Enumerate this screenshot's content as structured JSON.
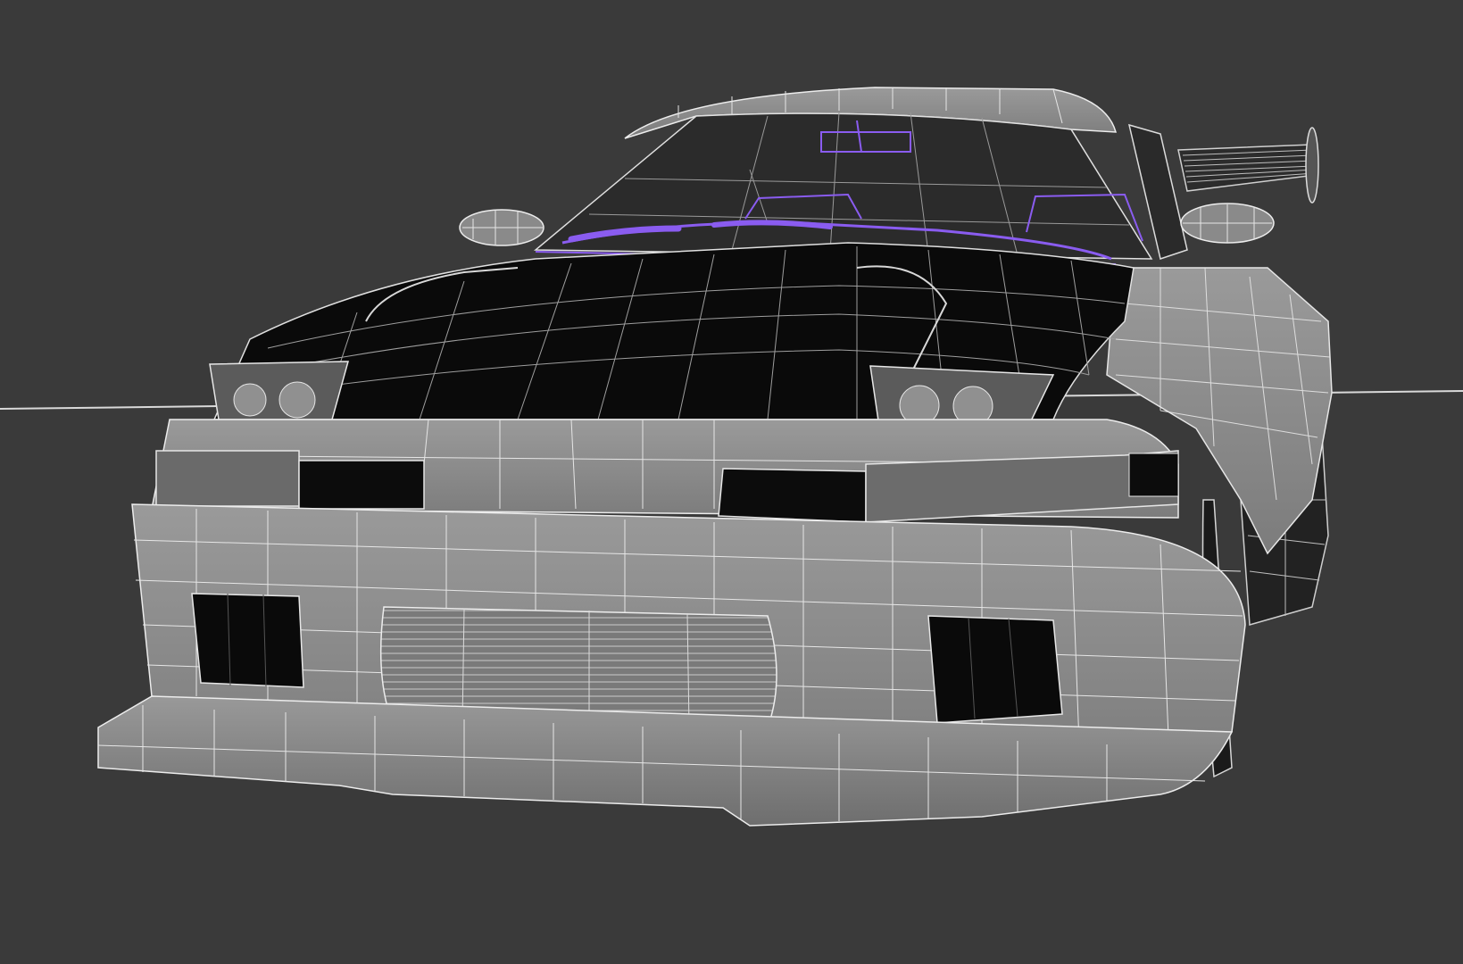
{
  "viewport": {
    "mode": "wireframe-on-shaded",
    "background_color": "#3a3a3a",
    "surface_color": "#8e8e8e",
    "wire_color": "#e6e6e6",
    "selection_color": "#8a5cf0",
    "opening_color": "#0b0b0b"
  },
  "model": {
    "subject": "car-body-mesh",
    "parts": [
      "roof",
      "windshield",
      "interior-selection",
      "side-mirror-left",
      "side-mirror-right",
      "rear-wing",
      "hood",
      "headlight-left",
      "headlight-right",
      "fender-right",
      "front-bumper",
      "upper-grille-left",
      "upper-grille-right",
      "intercooler-grille",
      "brake-duct-left",
      "brake-duct-right",
      "front-splitter",
      "front-wheel-right"
    ]
  }
}
